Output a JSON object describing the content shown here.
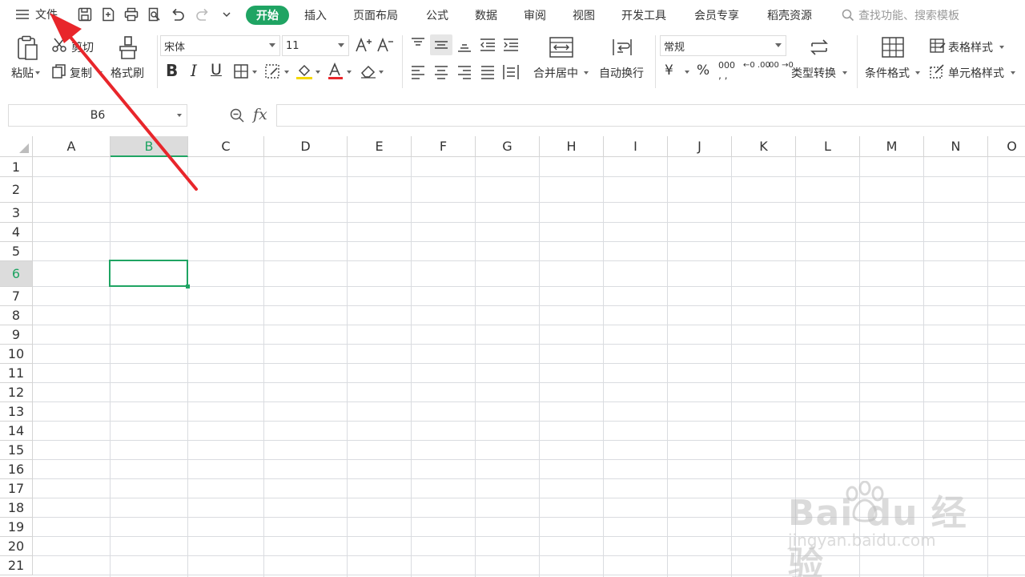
{
  "menubar": {
    "file_label": "文件",
    "tabs": [
      {
        "label": "开始",
        "active": true
      },
      {
        "label": "插入"
      },
      {
        "label": "页面布局"
      },
      {
        "label": "公式"
      },
      {
        "label": "数据"
      },
      {
        "label": "审阅"
      },
      {
        "label": "视图"
      },
      {
        "label": "开发工具"
      },
      {
        "label": "会员专享"
      },
      {
        "label": "稻壳资源"
      }
    ],
    "search_placeholder": "查找功能、搜索模板"
  },
  "ribbon": {
    "paste": "粘贴",
    "cut": "剪切",
    "copy": "复制",
    "format_painter": "格式刷",
    "font_name": "宋体",
    "font_size": "11",
    "merge_center": "合并居中",
    "wrap_text": "自动换行",
    "number_format": "常规",
    "type_convert": "类型转换",
    "conditional_format": "条件格式",
    "table_style": "表格样式",
    "cell_style": "单元格样式",
    "bold": "B",
    "italic": "I",
    "underline": "U",
    "currency": "¥",
    "percent": "%",
    "thousands": "000",
    "inc_decimal": "←0 .00",
    "dec_decimal": ".00 →0"
  },
  "formulabar": {
    "name_box": "B6",
    "fx": "fx",
    "value": ""
  },
  "grid": {
    "columns": [
      "A",
      "B",
      "C",
      "D",
      "E",
      "F",
      "G",
      "H",
      "I",
      "J",
      "K",
      "L",
      "M",
      "N",
      "O"
    ],
    "rows": [
      "1",
      "2",
      "3",
      "4",
      "5",
      "6",
      "7",
      "8",
      "9",
      "10",
      "11",
      "12",
      "13",
      "14",
      "15",
      "16",
      "17",
      "18",
      "19",
      "20",
      "21"
    ],
    "active_cell": "B6",
    "active_column": "B",
    "active_row": "6"
  },
  "watermark": {
    "main": "Bai du 经验",
    "sub": "jingyan.baidu.com"
  },
  "colors": {
    "accent": "#1fa463",
    "annotation_arrow": "#e8262b"
  }
}
